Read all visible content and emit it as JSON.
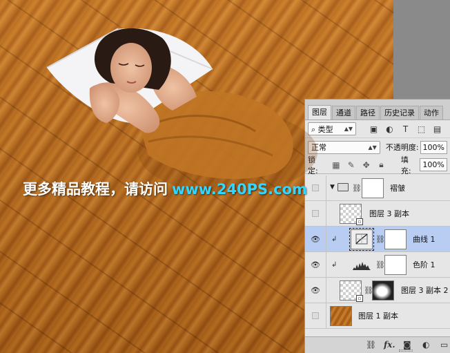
{
  "watermark": {
    "chinese": "更多精品教程，请访问",
    "url": "www.240PS.com"
  },
  "panel": {
    "tabs": [
      "图层",
      "通道",
      "路径",
      "历史记录",
      "动作"
    ],
    "filter": {
      "label": "类型"
    },
    "blend_mode": "正常",
    "opacity": {
      "label": "不透明度:",
      "value": "100%"
    },
    "lock": {
      "label": "锁定:"
    },
    "fill": {
      "label": "填充:",
      "value": "100%"
    },
    "layers": [
      {
        "name": "褶皱",
        "type": "group",
        "visible": false,
        "expanded": true
      },
      {
        "name": "图层 3 副本",
        "type": "smart-object",
        "visible": false
      },
      {
        "name": "曲线 1",
        "type": "curves-adjustment",
        "visible": true,
        "clipped": true,
        "selected": true
      },
      {
        "name": "色阶 1",
        "type": "levels-adjustment",
        "visible": true,
        "clipped": true
      },
      {
        "name": "图层 3 副本 2",
        "type": "smart-object-with-mask",
        "visible": true
      },
      {
        "name": "图层 1 副本",
        "type": "pixel",
        "visible": false
      }
    ],
    "bottom_icons": [
      "link-icon",
      "fx-icon",
      "add-mask-icon",
      "adjustment-icon",
      "folder-icon"
    ],
    "bottom_fx_label": "fx."
  },
  "colors": {
    "selected_row": "#b9cdf2",
    "url_text": "#33d6ff",
    "wood": "#b86b1f"
  }
}
